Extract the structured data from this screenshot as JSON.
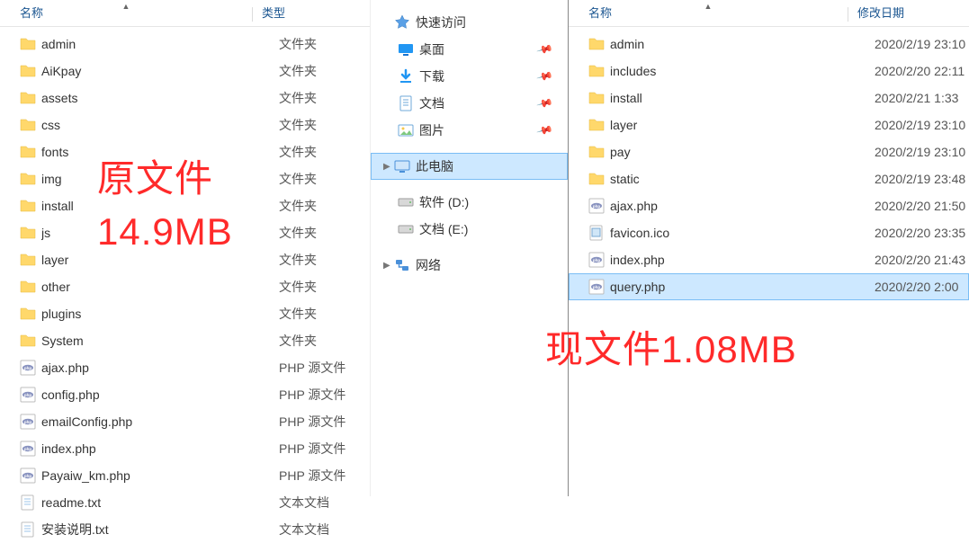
{
  "left": {
    "headers": {
      "name": "名称",
      "type": "类型"
    },
    "items": [
      {
        "icon": "folder",
        "name": "admin",
        "type": "文件夹"
      },
      {
        "icon": "folder",
        "name": "AiKpay",
        "type": "文件夹"
      },
      {
        "icon": "folder",
        "name": "assets",
        "type": "文件夹"
      },
      {
        "icon": "folder",
        "name": "css",
        "type": "文件夹"
      },
      {
        "icon": "folder",
        "name": "fonts",
        "type": "文件夹"
      },
      {
        "icon": "folder",
        "name": "img",
        "type": "文件夹"
      },
      {
        "icon": "folder",
        "name": "install",
        "type": "文件夹"
      },
      {
        "icon": "folder",
        "name": "js",
        "type": "文件夹"
      },
      {
        "icon": "folder",
        "name": "layer",
        "type": "文件夹"
      },
      {
        "icon": "folder",
        "name": "other",
        "type": "文件夹"
      },
      {
        "icon": "folder",
        "name": "plugins",
        "type": "文件夹"
      },
      {
        "icon": "folder",
        "name": "System",
        "type": "文件夹"
      },
      {
        "icon": "php",
        "name": "ajax.php",
        "type": "PHP 源文件"
      },
      {
        "icon": "php",
        "name": "config.php",
        "type": "PHP 源文件"
      },
      {
        "icon": "php",
        "name": "emailConfig.php",
        "type": "PHP 源文件"
      },
      {
        "icon": "php",
        "name": "index.php",
        "type": "PHP 源文件"
      },
      {
        "icon": "php",
        "name": "Payaiw_km.php",
        "type": "PHP 源文件"
      },
      {
        "icon": "txt",
        "name": "readme.txt",
        "type": "文本文档"
      },
      {
        "icon": "txt",
        "name": "安装说明.txt",
        "type": "文本文档"
      }
    ]
  },
  "nav": {
    "quick_access": "快速访问",
    "items": [
      {
        "icon": "desktop",
        "label": "桌面",
        "pinned": true
      },
      {
        "icon": "download",
        "label": "下载",
        "pinned": true
      },
      {
        "icon": "document",
        "label": "文档",
        "pinned": true
      },
      {
        "icon": "picture",
        "label": "图片",
        "pinned": true
      }
    ],
    "this_pc": "此电脑",
    "drives": [
      {
        "icon": "drive",
        "label": "软件 (D:)"
      },
      {
        "icon": "drive",
        "label": "文档 (E:)"
      }
    ],
    "network": "网络"
  },
  "right": {
    "headers": {
      "name": "名称",
      "date": "修改日期"
    },
    "items": [
      {
        "icon": "folder",
        "name": "admin",
        "date": "2020/2/19 23:10"
      },
      {
        "icon": "folder",
        "name": "includes",
        "date": "2020/2/20 22:11"
      },
      {
        "icon": "folder",
        "name": "install",
        "date": "2020/2/21 1:33"
      },
      {
        "icon": "folder",
        "name": "layer",
        "date": "2020/2/19 23:10"
      },
      {
        "icon": "folder",
        "name": "pay",
        "date": "2020/2/19 23:10"
      },
      {
        "icon": "folder",
        "name": "static",
        "date": "2020/2/19 23:48"
      },
      {
        "icon": "php",
        "name": "ajax.php",
        "date": "2020/2/20 21:50"
      },
      {
        "icon": "ico",
        "name": "favicon.ico",
        "date": "2020/2/20 23:35"
      },
      {
        "icon": "php",
        "name": "index.php",
        "date": "2020/2/20 21:43"
      },
      {
        "icon": "php",
        "name": "query.php",
        "date": "2020/2/20 2:00",
        "selected": true
      }
    ]
  },
  "annotations": {
    "left_line1": "原文件",
    "left_line2": "14.9MB",
    "right": "现文件1.08MB"
  }
}
